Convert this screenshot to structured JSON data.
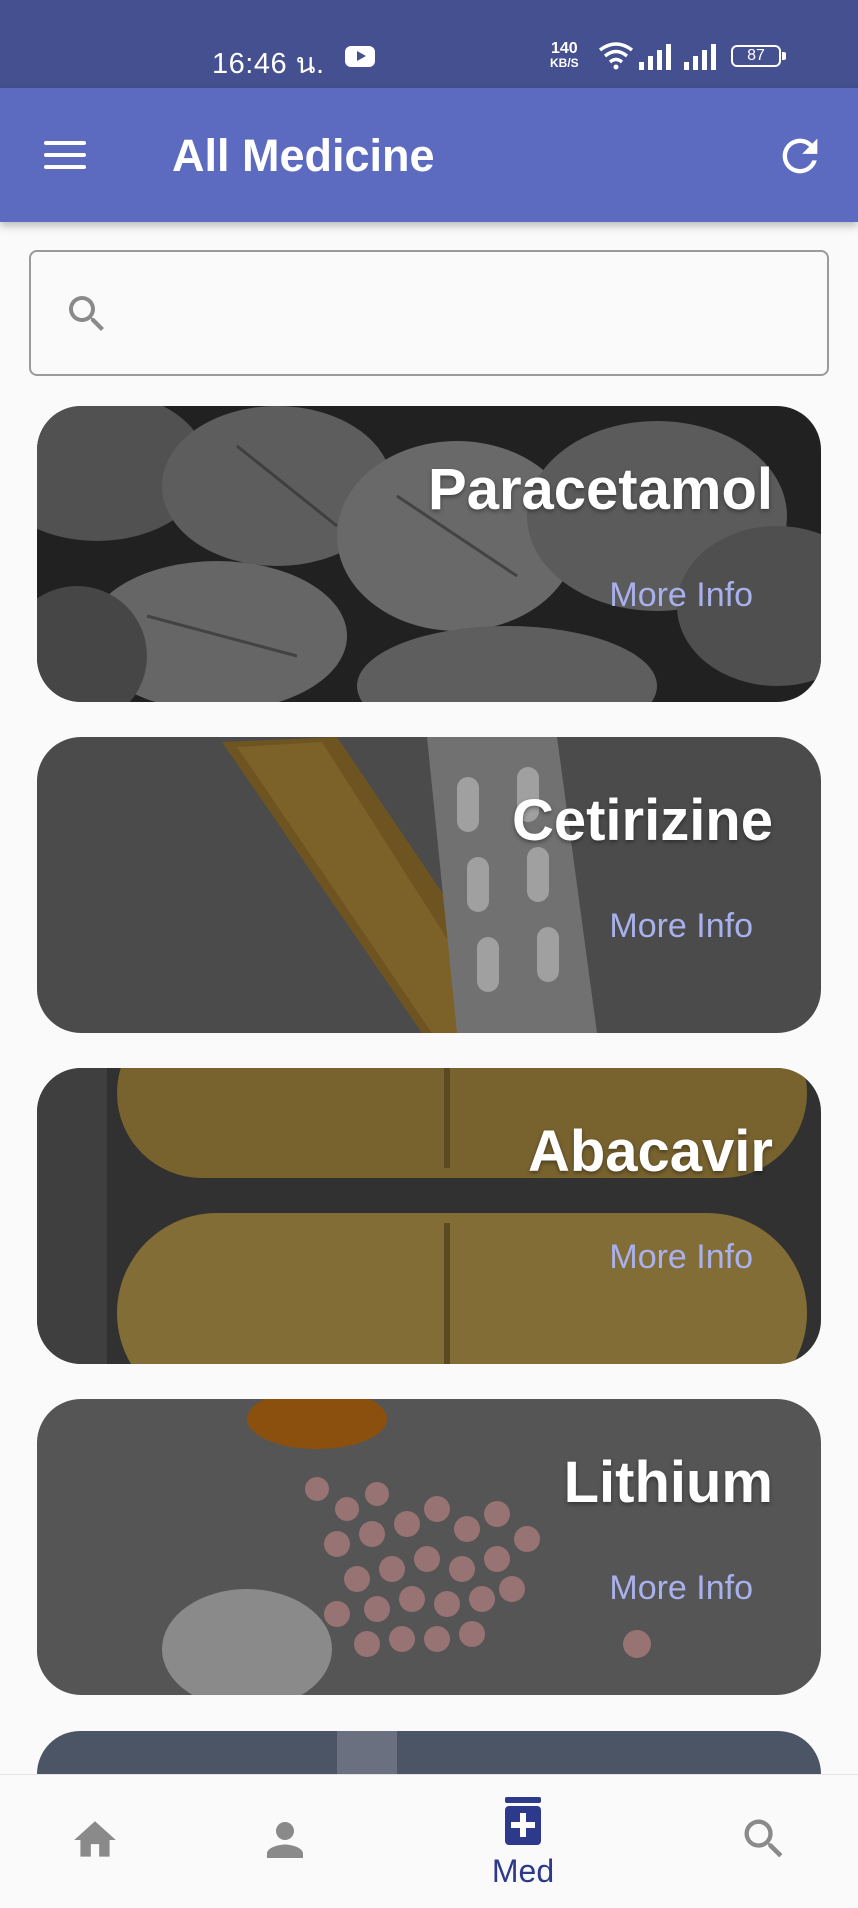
{
  "status_bar": {
    "time": "16:46 น.",
    "net_speed_value": "140",
    "net_speed_unit": "KB/S",
    "battery": "87"
  },
  "app_bar": {
    "title": "All Medicine"
  },
  "search": {
    "placeholder": "",
    "value": ""
  },
  "medicines": [
    {
      "name": "Paracetamol",
      "action": "More Info"
    },
    {
      "name": "Cetirizine",
      "action": "More Info"
    },
    {
      "name": "Abacavir",
      "action": "More Info"
    },
    {
      "name": "Lithium",
      "action": "More Info"
    }
  ],
  "bottom_nav": {
    "active_label": "Med"
  },
  "colors": {
    "status_bar": "#44508f",
    "app_bar": "#5c6bc0",
    "accent": "#2d3a8c",
    "more_info": "#a9b1ec",
    "inactive_icon": "#8a8a8a"
  }
}
